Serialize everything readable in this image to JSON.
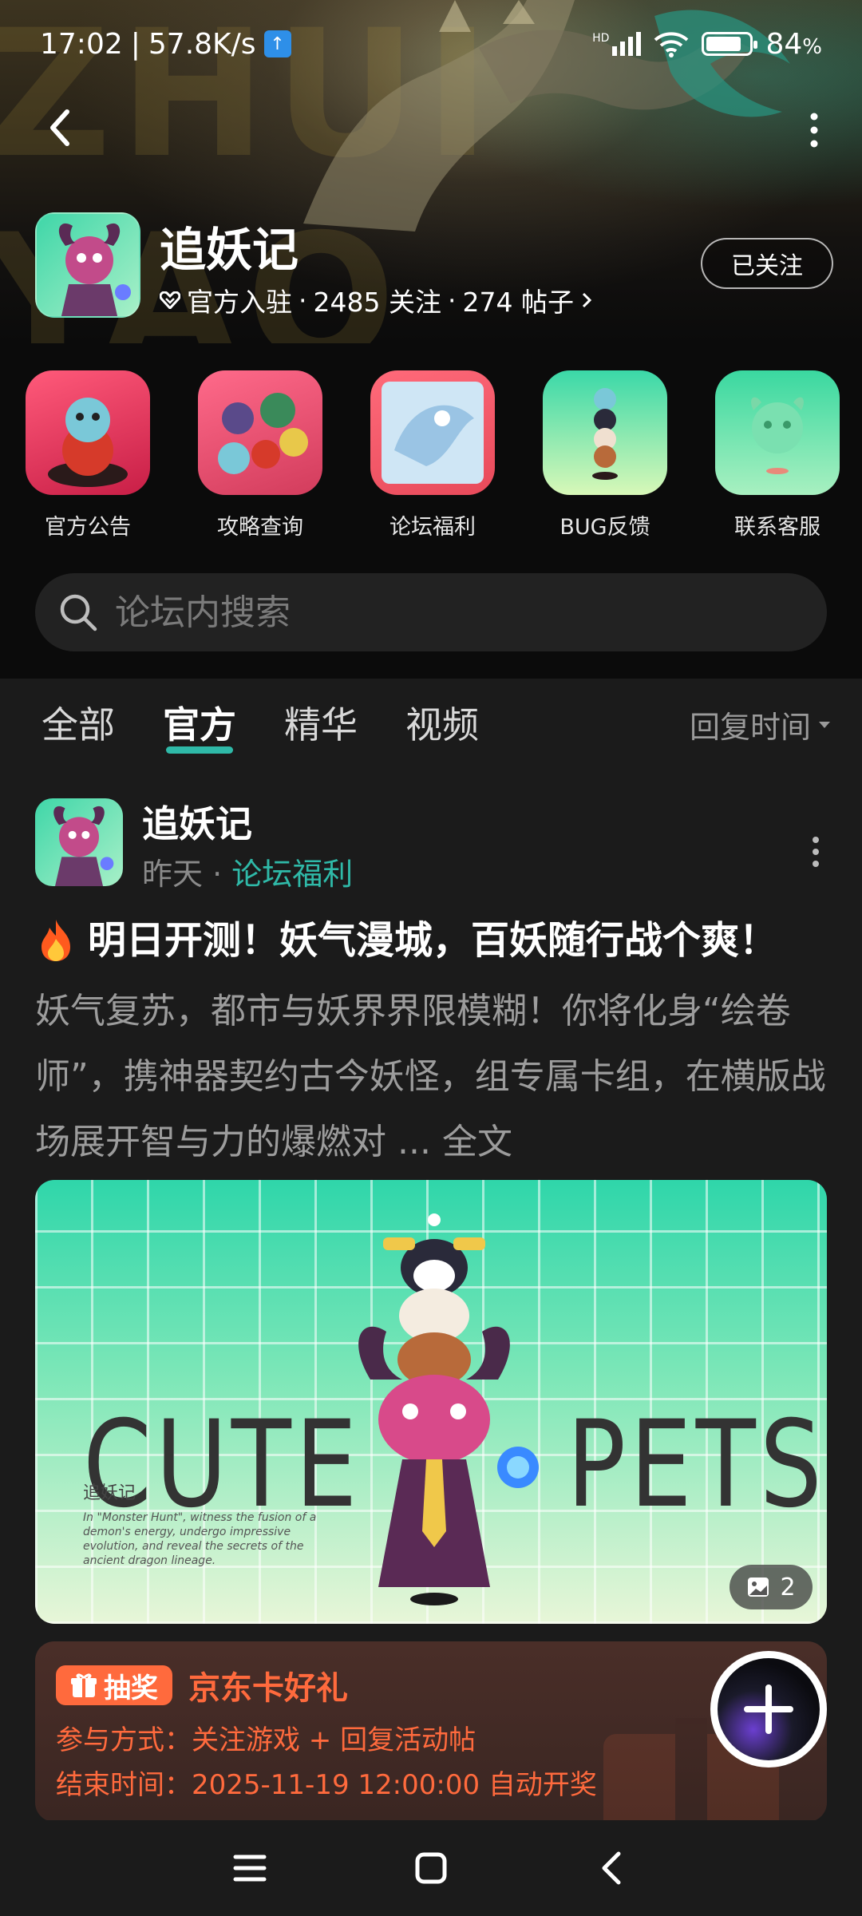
{
  "status": {
    "time": "17:02",
    "speed": "57.8K/s",
    "network": "HD",
    "battery": "84",
    "battery_unit": "%",
    "battery_level": 0.84
  },
  "game": {
    "title": "追妖记",
    "official_badge": "官方入驻",
    "followers": "2485 关注",
    "posts": "274 帖子",
    "follow_label": "已关注"
  },
  "quick_entries": [
    {
      "label": "官方公告"
    },
    {
      "label": "攻略查询"
    },
    {
      "label": "论坛福利"
    },
    {
      "label": "BUG反馈"
    },
    {
      "label": "联系客服"
    }
  ],
  "search": {
    "placeholder": "论坛内搜索"
  },
  "tabs": [
    {
      "label": "全部"
    },
    {
      "label": "官方"
    },
    {
      "label": "精华"
    },
    {
      "label": "视频"
    }
  ],
  "active_tab": "官方",
  "sort_label": "回复时间",
  "post": {
    "author": "追妖记",
    "time": "昨天",
    "separator": "·",
    "board": "论坛福利",
    "title": "明日开测！妖气漫城，百妖随行战个爽！",
    "body": "妖气复苏，都市与妖界界限模糊！你将化身“绘卷师”，携神器契约古今妖怪，组专属卡组，在横版战场展开智与力的爆燃对",
    "ellipsis": "...",
    "full_text_label": "全文",
    "image": {
      "word_left": "CUTE",
      "word_right": "PETS",
      "logo": "追妖记",
      "caption": "In \"Monster Hunt\", witness the fusion of a demon's energy, undergo impressive evolution, and reveal the secrets of the ancient dragon lineage.",
      "count": "2"
    },
    "lottery": {
      "badge": "抽奖",
      "prize": "京东卡好礼",
      "method": "参与方式：关注游戏 + 回复活动帖",
      "end": "结束时间：2025-11-19 12:00:00 自动开奖"
    }
  },
  "colors": {
    "accent": "#2fb9a8",
    "lottery": "#ff6a3d",
    "bg": "#1b1b1b"
  },
  "icons": {
    "back": "chevron-left-icon",
    "more": "more-vertical-icon",
    "search": "search-icon",
    "add": "plus-icon",
    "menu": "menu-icon",
    "home": "square-home-icon",
    "nav_back": "chevron-left-icon"
  }
}
